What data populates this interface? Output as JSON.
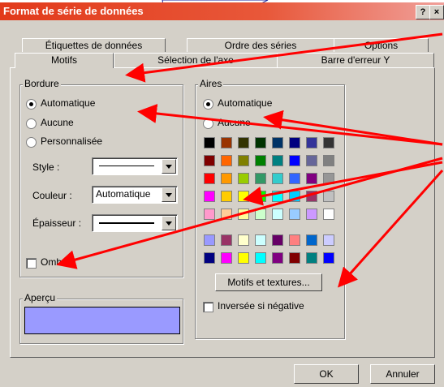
{
  "title": "Format de série de données",
  "title_buttons": [
    "?",
    "×"
  ],
  "tabs_row1": [
    "Étiquettes de données",
    "Ordre des séries",
    "Options"
  ],
  "tabs_row2": [
    "Motifs",
    "Sélection de l'axe",
    "Barre d'erreur Y"
  ],
  "bordure": {
    "group_label": "Bordure",
    "radios": [
      "Automatique",
      "Aucune",
      "Personnalisée"
    ],
    "selected": 0,
    "style_label": "Style :",
    "couleur_label": "Couleur :",
    "couleur_value": "Automatique",
    "epaisseur_label": "Épaisseur :",
    "ombre_label": "Ombre"
  },
  "apercu": {
    "label": "Aperçu",
    "color": "#9a9aff"
  },
  "aires": {
    "group_label": "Aires",
    "radios": [
      "Automatique",
      "Aucune"
    ],
    "selected": 0,
    "palette": [
      [
        "#000000",
        "#993300",
        "#333300",
        "#003300",
        "#003366",
        "#000080",
        "#333399",
        "#333333"
      ],
      [
        "#800000",
        "#ff6600",
        "#808000",
        "#008000",
        "#008080",
        "#0000ff",
        "#666699",
        "#808080"
      ],
      [
        "#ff0000",
        "#ff9900",
        "#99cc00",
        "#339966",
        "#33cccc",
        "#3366ff",
        "#800080",
        "#969696"
      ],
      [
        "#ff00ff",
        "#ffcc00",
        "#ffff00",
        "#00ff00",
        "#00ffff",
        "#00ccff",
        "#993366",
        "#c0c0c0"
      ],
      [
        "#ff99cc",
        "#ffcc99",
        "#ffff99",
        "#ccffcc",
        "#ccffff",
        "#99ccff",
        "#cc99ff",
        "#ffffff"
      ]
    ],
    "palette2": [
      [
        "#9999ff",
        "#993366",
        "#ffffcc",
        "#ccffff",
        "#660066",
        "#ff8080",
        "#0066cc",
        "#ccccff"
      ],
      [
        "#000080",
        "#ff00ff",
        "#ffff00",
        "#00ffff",
        "#800080",
        "#800000",
        "#008080",
        "#0000ff"
      ]
    ],
    "motifs_button": "Motifs et textures...",
    "inversee_label": "Inversée si négative"
  },
  "buttons": {
    "ok": "OK",
    "annuler": "Annuler"
  },
  "colors": {
    "titlebar": "#e23a1a",
    "arrow": "#ff0000",
    "dialog_bg": "#d4d0c8"
  }
}
